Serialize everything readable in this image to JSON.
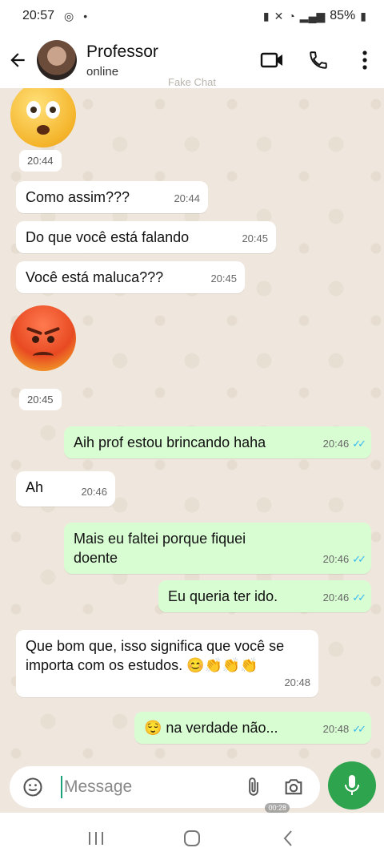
{
  "status_bar": {
    "time": "20:57",
    "battery": "85%"
  },
  "header": {
    "contact_name": "Professor",
    "status": "online",
    "watermark": "Fake Chat"
  },
  "messages": [
    {
      "id": "m0",
      "time": "20:44"
    },
    {
      "id": "m1",
      "text": "Como assim???",
      "time": "20:44"
    },
    {
      "id": "m2",
      "text": "Do que você está falando",
      "time": "20:45"
    },
    {
      "id": "m3",
      "text": "Você está maluca???",
      "time": "20:45"
    },
    {
      "id": "m4",
      "time": "20:45"
    },
    {
      "id": "m5",
      "text": "Aih prof estou brincando haha",
      "time": "20:46"
    },
    {
      "id": "m6",
      "text": "Ah",
      "time": "20:46"
    },
    {
      "id": "m7",
      "text": "Mais eu faltei porque fiquei doente",
      "time": "20:46"
    },
    {
      "id": "m8",
      "text": "Eu queria ter ido.",
      "time": "20:46"
    },
    {
      "id": "m9",
      "text": "Que bom que, isso significa que você se importa com os estudos. 😊👏👏👏",
      "time": "20:48"
    },
    {
      "id": "m10",
      "text": "😌 na verdade não...",
      "time": "20:48"
    }
  ],
  "input": {
    "placeholder": "Message",
    "recording_time": "00:28"
  },
  "icons": {
    "back": "arrow-left-icon",
    "video": "video-call-icon",
    "call": "phone-icon",
    "menu": "more-vert-icon",
    "sticker": "sticker-icon",
    "attach": "paperclip-icon",
    "camera": "camera-icon",
    "mic": "microphone-icon"
  },
  "colors": {
    "outgoing": "#d9fdd3",
    "incoming": "#ffffff",
    "chat_bg": "#efe7dd",
    "accent": "#2ea44f",
    "read_tick": "#34b7f1"
  }
}
